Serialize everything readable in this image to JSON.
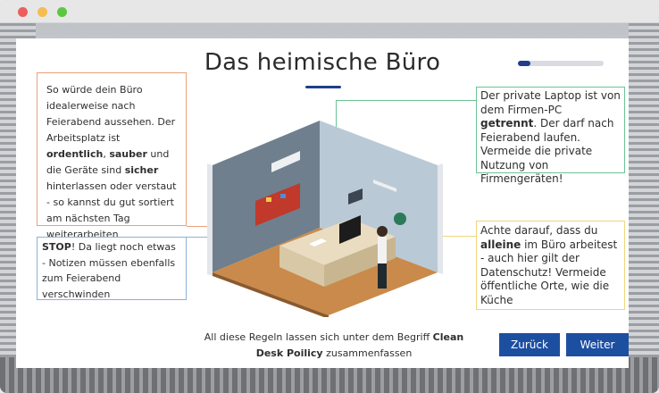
{
  "window": {
    "controls": [
      "close",
      "minimize",
      "maximize"
    ]
  },
  "slide": {
    "title": "Das heimische Büro",
    "progress_fraction": 0.15
  },
  "callouts": {
    "orange": {
      "t1": "So würde dein Büro idealerweise nach Feierabend aussehen. Der Arbeitsplatz ist ",
      "b1": "ordentlich",
      "t2": ", ",
      "b2": "sauber",
      "t3": " und die Geräte sind ",
      "b3": "sicher",
      "t4": " hinterlassen oder verstaut - so kannst du gut sortiert am nächsten Tag weiterarbeiten"
    },
    "blue": {
      "b1": "STOP",
      "t1": "! Da liegt noch etwas - Notizen müssen ebenfalls zum Feierabend verschwinden"
    },
    "green": {
      "t1": "Der private Laptop ist von dem Firmen-PC ",
      "b1": "getrennt",
      "t2": ". Der darf nach Feierabend laufen. Vermeide die private Nutzung von Firmengeräten!"
    },
    "yellow": {
      "t1": "Achte darauf, dass du ",
      "b1": "alleine",
      "t2": " im Büro arbeitest - auch hier gilt der Datenschutz! Vermeide öffentliche Orte, wie die Küche"
    }
  },
  "footer": {
    "t1": "All diese Regeln lassen sich unter dem Begriff ",
    "b1": "Clean Desk Poilicy",
    "t2": " zusammenfassen"
  },
  "buttons": {
    "back": "Zurück",
    "next": "Weiter"
  },
  "colors": {
    "accent": "#1d4fa1",
    "orange_border": "#e9a07a",
    "blue_border": "#8ab2d9",
    "green_border": "#6cc394",
    "yellow_border": "#f0d57b"
  }
}
